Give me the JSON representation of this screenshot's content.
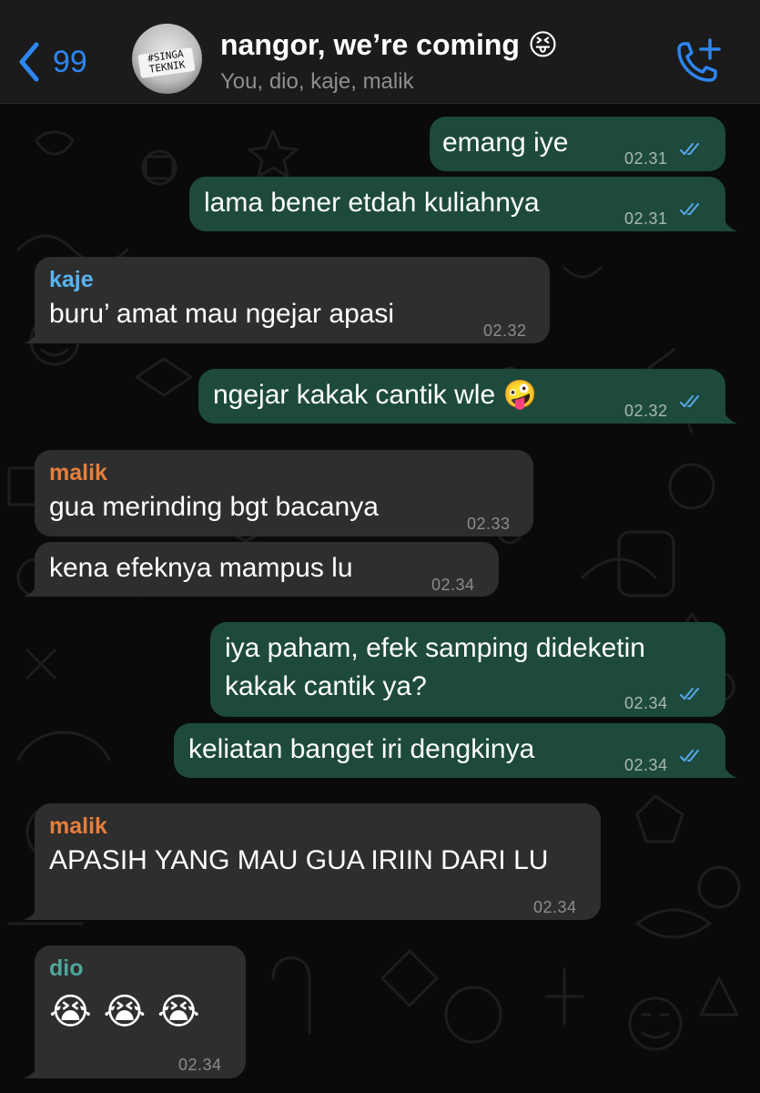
{
  "header": {
    "back_count": "99",
    "title": "nangor, we’re coming",
    "title_emoji": "😝",
    "subtitle": "You, dio, kaje, malik",
    "avatar_text": "#SINGA TEKNIK",
    "back_icon": "chevron-left-icon",
    "call_icon": "add-call-icon",
    "accent_color": "#2e86f0"
  },
  "colors": {
    "outgoing_bubble": "#1e4a3d",
    "incoming_bubble": "#2e2e2e",
    "kaje": "#5ab4f0",
    "malik": "#e57f3c",
    "dio": "#4fa69a",
    "read_ticks": "#57a8e8"
  },
  "messages": [
    {
      "dir": "out",
      "text": "emang iye",
      "time": "02.31",
      "status": "read"
    },
    {
      "dir": "out",
      "text": "lama bener etdah kuliahnya",
      "time": "02.31",
      "status": "read"
    },
    {
      "dir": "in",
      "sender": "kaje",
      "text": "buru’ amat mau ngejar apasi",
      "time": "02.32"
    },
    {
      "dir": "out",
      "text": "ngejar kakak cantik wle",
      "emoji": "🤪",
      "time": "02.32",
      "status": "read"
    },
    {
      "dir": "in",
      "sender": "malik",
      "text": "gua merinding bgt bacanya",
      "time": "02.33"
    },
    {
      "dir": "in",
      "text": "kena efeknya mampus lu",
      "time": "02.34"
    },
    {
      "dir": "out",
      "line1": "iya paham, efek samping dideketin",
      "line2": "kakak cantik ya?",
      "time": "02.34",
      "status": "read"
    },
    {
      "dir": "out",
      "text": "keliatan banget iri dengkinya",
      "time": "02.34",
      "status": "read"
    },
    {
      "dir": "in",
      "sender": "malik",
      "text": "APASIH YANG MAU GUA IRIIN DARI LU",
      "time": "02.34"
    },
    {
      "dir": "in",
      "sender": "dio",
      "emoji": "😭 😭 😭",
      "time": "02.34"
    }
  ]
}
